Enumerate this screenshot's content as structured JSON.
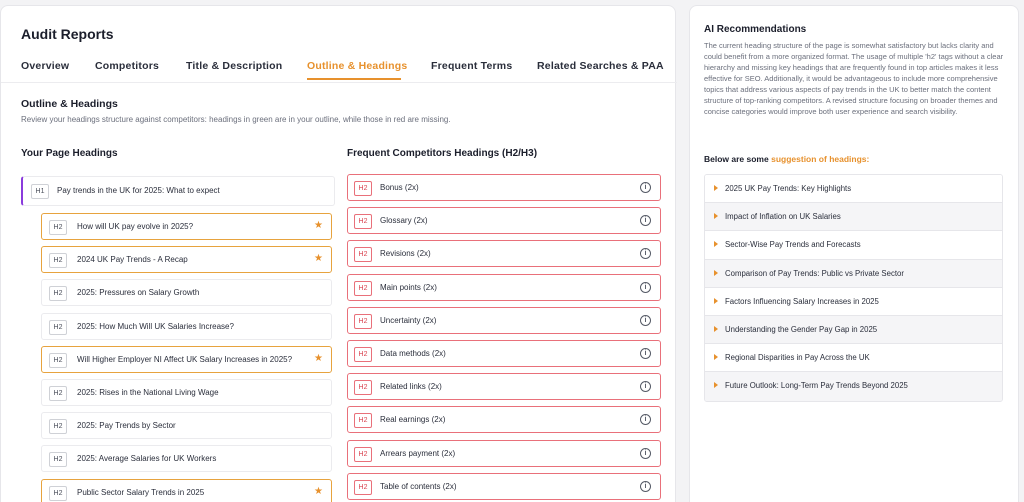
{
  "header": {
    "title": "Audit Reports"
  },
  "tabs": [
    {
      "label": "Overview",
      "active": false
    },
    {
      "label": "Competitors",
      "active": false
    },
    {
      "label": "Title & Description",
      "active": false
    },
    {
      "label": "Outline & Headings",
      "active": true
    },
    {
      "label": "Frequent Terms",
      "active": false
    },
    {
      "label": "Related Searches & PAA",
      "active": false
    }
  ],
  "section": {
    "title": "Outline & Headings",
    "description": "Review your headings structure against competitors: headings in green are in your outline, while those in red are missing."
  },
  "your_headings": {
    "title": "Your Page Headings",
    "h1": {
      "tag": "H1",
      "text": "Pay trends in the UK for 2025: What to expect"
    },
    "items": [
      {
        "tag": "H2",
        "text": "How will UK pay evolve in 2025?",
        "starred": true
      },
      {
        "tag": "H2",
        "text": "2024 UK Pay Trends - A Recap",
        "starred": true
      },
      {
        "tag": "H2",
        "text": "2025: Pressures on Salary Growth",
        "starred": false
      },
      {
        "tag": "H2",
        "text": "2025: How Much Will UK Salaries Increase?",
        "starred": false
      },
      {
        "tag": "H2",
        "text": "Will Higher Employer NI Affect UK Salary Increases in 2025?",
        "starred": true
      },
      {
        "tag": "H2",
        "text": "2025: Rises in the National Living Wage",
        "starred": false
      },
      {
        "tag": "H2",
        "text": "2025: Pay Trends by Sector",
        "starred": false
      },
      {
        "tag": "H2",
        "text": "2025: Average Salaries for UK Workers",
        "starred": false
      },
      {
        "tag": "H2",
        "text": "Public Sector Salary Trends in 2025",
        "starred": true
      }
    ]
  },
  "competitor_headings": {
    "title": "Frequent Competitors Headings (H2/H3)",
    "items": [
      {
        "tag": "H2",
        "text": "Bonus (2x)"
      },
      {
        "tag": "H2",
        "text": "Glossary (2x)"
      },
      {
        "tag": "H2",
        "text": "Revisions (2x)"
      },
      {
        "tag": "H2",
        "text": "Main points (2x)"
      },
      {
        "tag": "H2",
        "text": "Uncertainty (2x)"
      },
      {
        "tag": "H2",
        "text": "Data methods (2x)"
      },
      {
        "tag": "H2",
        "text": "Related links (2x)"
      },
      {
        "tag": "H2",
        "text": "Real earnings (2x)"
      },
      {
        "tag": "H2",
        "text": "Arrears payment (2x)"
      },
      {
        "tag": "H2",
        "text": "Table of contents (2x)"
      }
    ]
  },
  "ai": {
    "title": "AI Recommendations",
    "paragraph": "The current heading structure of the page is somewhat satisfactory but lacks clarity and could benefit from a more organized format. The usage of multiple 'h2' tags without a clear hierarchy and missing key headings that are frequently found in top articles makes it less effective for SEO. Additionally, it would be advantageous to include more comprehensive topics that address various aspects of pay trends in the UK to better match the content structure of top-ranking competitors. A revised structure focusing on broader themes and concise categories would improve both user experience and search visibility.",
    "suggest_prefix": "Below are some",
    "suggest_highlight": "suggestion of headings:",
    "suggestions": [
      "2025 UK Pay Trends: Key Highlights",
      "Impact of Inflation on UK Salaries",
      "Sector-Wise Pay Trends and Forecasts",
      "Comparison of Pay Trends: Public vs Private Sector",
      "Factors Influencing Salary Increases in 2025",
      "Understanding the Gender Pay Gap in 2025",
      "Regional Disparities in Pay Across the UK",
      "Future Outlook: Long-Term Pay Trends Beyond 2025"
    ]
  },
  "icons": {
    "star": "star-icon",
    "info": "info-icon",
    "caret": "caret-right-icon"
  },
  "colors": {
    "accent": "#e7912d",
    "missing": "#e9707a",
    "h1_marker": "#8a3bdc"
  }
}
